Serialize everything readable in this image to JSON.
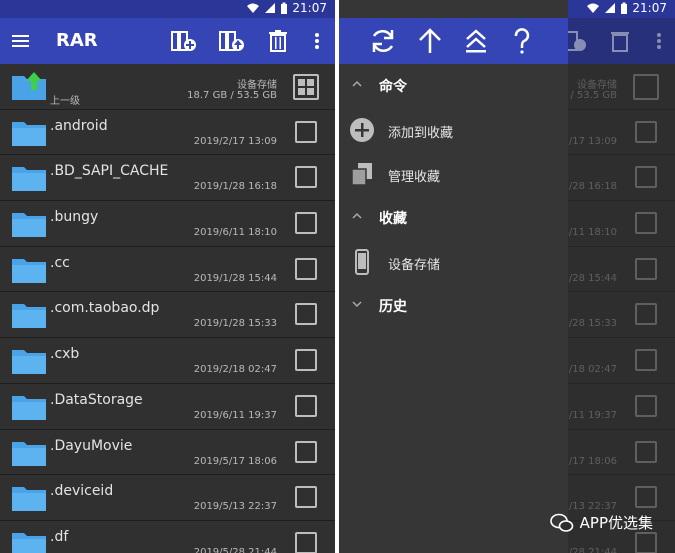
{
  "status": {
    "time": "21:07"
  },
  "left": {
    "app_title": "RAR",
    "parent_row": {
      "label": "上一级",
      "storage": "设备存储",
      "size": "18.7 GB / 53.5 GB"
    },
    "files": [
      {
        "name": ".android",
        "date": "2019/2/17 13:09"
      },
      {
        "name": ".BD_SAPI_CACHE",
        "date": "2019/1/28 16:18"
      },
      {
        "name": ".bungy",
        "date": "2019/6/11 18:10"
      },
      {
        "name": ".cc",
        "date": "2019/1/28 15:44"
      },
      {
        "name": ".com.taobao.dp",
        "date": "2019/1/28 15:33"
      },
      {
        "name": ".cxb",
        "date": "2019/2/18 02:47"
      },
      {
        "name": ".DataStorage",
        "date": "2019/6/11 19:37"
      },
      {
        "name": ".DayuMovie",
        "date": "2019/5/17 18:06"
      },
      {
        "name": ".deviceid",
        "date": "2019/5/13 22:37"
      },
      {
        "name": ".df",
        "date": "2019/5/28 21:44"
      }
    ]
  },
  "drawer": {
    "sections": [
      {
        "title": "命令",
        "items": [
          "添加到收藏",
          "管理收藏"
        ]
      },
      {
        "title": "收藏",
        "items": [
          "设备存储"
        ]
      },
      {
        "title": "历史",
        "items": []
      }
    ]
  },
  "watermark": "APP优选集",
  "icons": [
    "menu-icon",
    "add-archive-icon",
    "extract-icon",
    "delete-icon",
    "more-icon",
    "refresh-icon",
    "up-arrow-icon",
    "collapse-icon",
    "help-icon",
    "folder-icon",
    "checkbox-icon",
    "grid-icon",
    "add-circle-icon",
    "copy-icon",
    "phone-icon",
    "chevron-up-icon",
    "chevron-down-icon",
    "wechat-icon"
  ],
  "colors": {
    "appbar": "#3645b6",
    "statusbar": "#2a3799",
    "background": "#2d2d2d",
    "folder": "#4aa3e6"
  }
}
